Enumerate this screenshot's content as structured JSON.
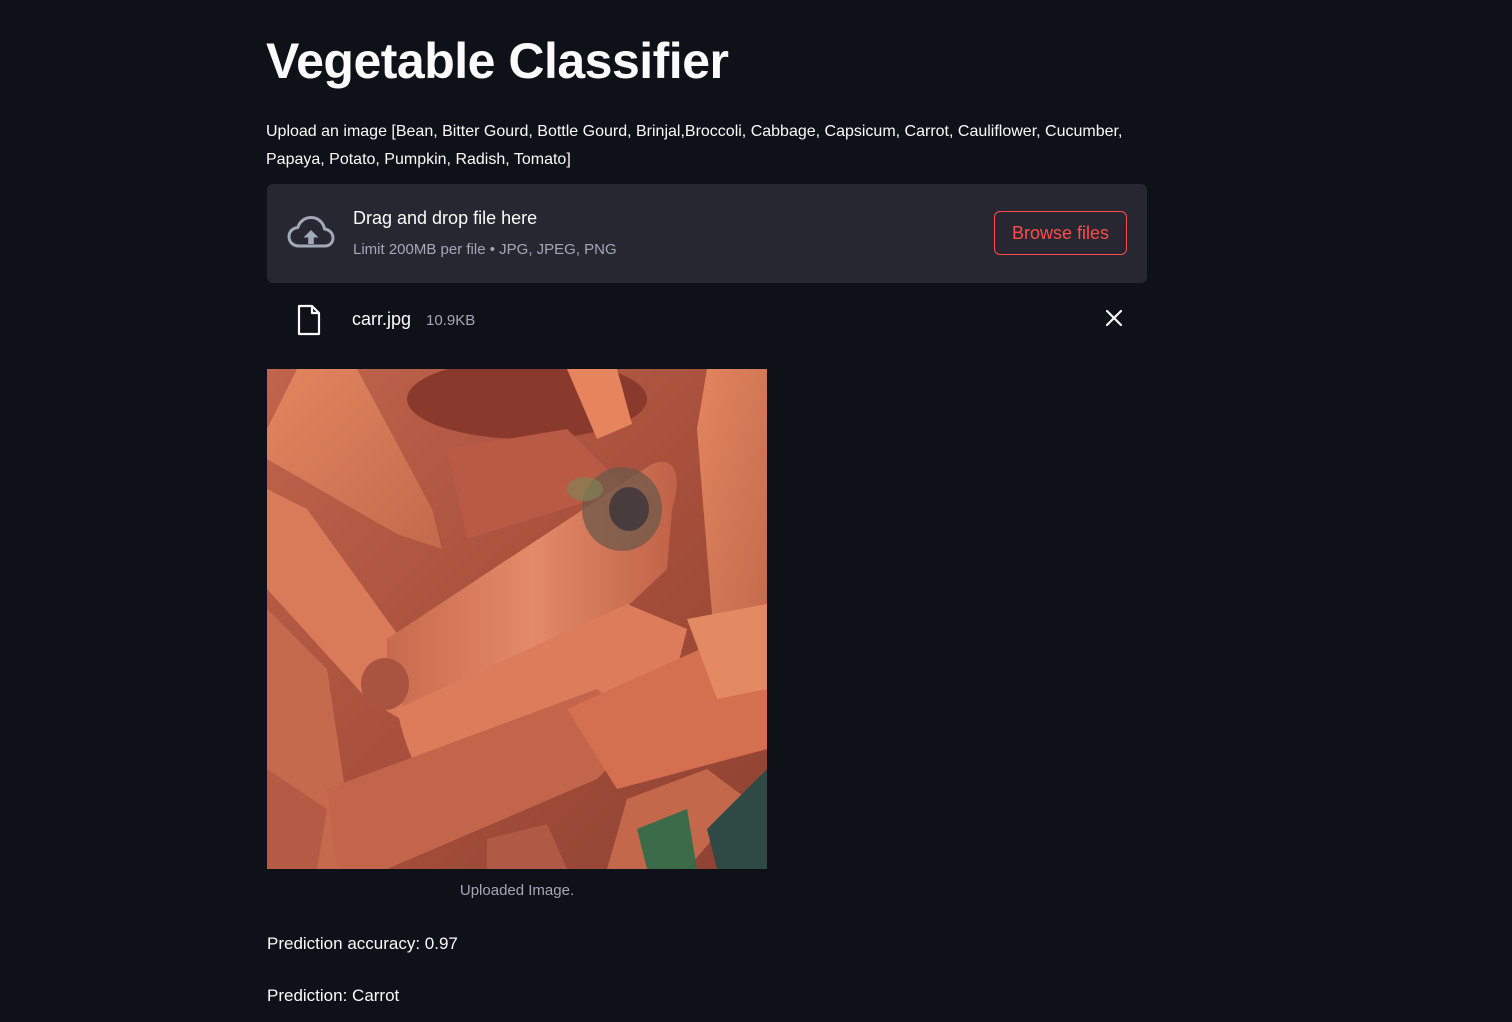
{
  "app": {
    "title": "Vegetable Classifier",
    "description": "Upload an image [Bean, Bitter Gourd, Bottle Gourd, Brinjal,Broccoli, Cabbage, Capsicum, Carrot, Cauliflower, Cucumber, Papaya, Potato, Pumpkin, Radish, Tomato]"
  },
  "uploader": {
    "drag_label": "Drag and drop file here",
    "limit_label": "Limit 200MB per file • JPG, JPEG, PNG",
    "browse_label": "Browse files",
    "icon": "cloud-upload-icon"
  },
  "uploaded_file": {
    "name": "carr.jpg",
    "size": "10.9KB",
    "icon": "file-icon",
    "remove_icon": "close-icon"
  },
  "image": {
    "caption": "Uploaded Image."
  },
  "results": {
    "accuracy_text": "Prediction accuracy: 0.97",
    "prediction_text": "Prediction: Carrot"
  },
  "colors": {
    "background": "#0e1117",
    "panel": "#262730",
    "accent": "#ff4b4b",
    "text": "#fafafa",
    "muted": "#a3a8b8"
  }
}
